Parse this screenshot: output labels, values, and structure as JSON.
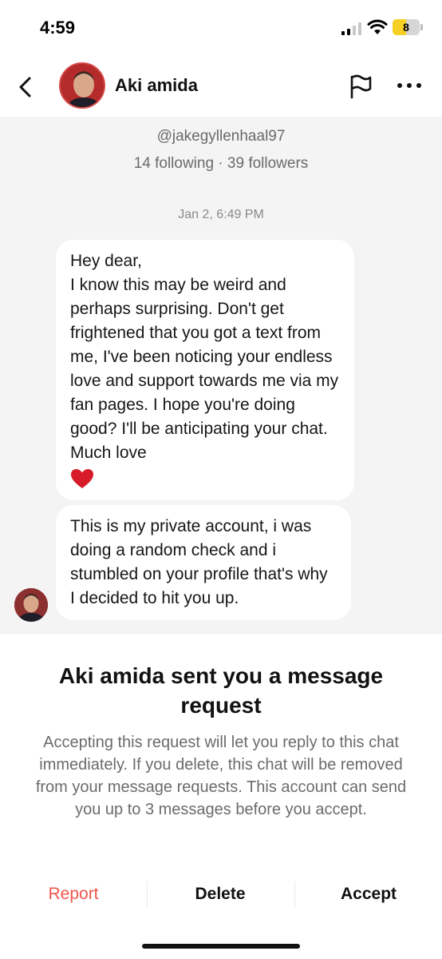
{
  "status_bar": {
    "time": "4:59",
    "battery_level": "8",
    "icons": [
      "signal-icon",
      "wifi-icon",
      "battery-icon"
    ]
  },
  "header": {
    "name": "Aki amida",
    "icons": [
      "back-icon",
      "avatar",
      "flag-icon",
      "more-icon"
    ]
  },
  "profile": {
    "handle": "@jakegyllenhaal97",
    "stats": "14 following · 39 followers"
  },
  "chat": {
    "timestamp": "Jan 2, 6:49 PM",
    "messages": [
      {
        "text": "Hey dear,\nI know this may be weird and perhaps surprising. Don't get frightened that you got a text from me, I've been noticing your endless love and support towards me via my fan pages. I hope you're doing good? I'll be anticipating your chat. Much love",
        "emoji": "heart-icon"
      },
      {
        "text": "This is my private account, i was doing a random check and i stumbled on your profile that's why I decided to hit you up."
      }
    ]
  },
  "request": {
    "title": "Aki amida sent you a message request",
    "description": "Accepting this request will let you reply to this chat immediately. If you delete, this chat will be removed from your message requests. This account can send you up to 3 messages before you accept.",
    "report_label": "Report",
    "delete_label": "Delete",
    "accept_label": "Accept"
  },
  "colors": {
    "report": "#f0554d",
    "chat_background": "#f4f4f4",
    "battery": "#f5cf23"
  }
}
